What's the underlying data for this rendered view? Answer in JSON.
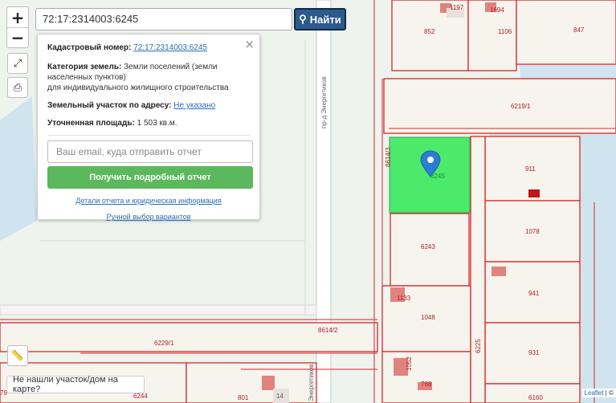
{
  "search": {
    "value": "72:17:2314003:6245",
    "button_label": "Найти",
    "button_icon": "search-icon"
  },
  "controls": {
    "zoom_in": "+",
    "zoom_out": "−",
    "fullscreen_icon": "expand-icon",
    "print_icon": "print-icon",
    "measure_icon": "ruler-icon"
  },
  "popup": {
    "cadastral_label": "Кадастровый номер:",
    "cadastral_value": "72:17:2314003:6245",
    "category_label": "Категория земель:",
    "category_value_line1": "Земли поселений (земли",
    "category_value_line2": "населенных пунктов)",
    "category_value_line3": "для индивидуального жилищного строительства",
    "address_label": "Земельный участок по адресу:",
    "address_value": "Не указано",
    "area_label": "Уточненная площадь:",
    "area_value": "1 503 кв.м.",
    "email_placeholder": "Ваш email, куда отправить отчет",
    "report_button": "Получить подробный отчет",
    "details_link": "Детали отчета и юридическая информация",
    "manual_link": "Ручной выбор вариантов",
    "close": "×"
  },
  "map": {
    "selected_parcel_label": "6245",
    "parcel_labels": [
      "1197",
      "1694",
      "852",
      "1106",
      "847",
      "6219/1",
      "8614/3",
      "911",
      "1078",
      "6243",
      "941",
      "1133",
      "1048",
      "8614/2",
      "6229/1",
      "6225",
      "931",
      "1052",
      "768",
      "6244",
      "801",
      "14",
      "6160",
      "79"
    ],
    "street_labels": [
      "пр-д Энергетиков",
      "Энергетиков"
    ],
    "colors": {
      "background": "#eef3ee",
      "parcel_fill": "#f7f4ee",
      "parcel_border": "#d9262a",
      "selected_fill": "#4cea6a",
      "water": "#cfe4ee",
      "road": "#ffffff",
      "building": "#e0837e",
      "marker": "#2a7fd4"
    }
  },
  "bottom": {
    "not_found": "Не нашли участок/дом на карте?",
    "attribution_link": "Leaflet",
    "attribution_sep": " | ©"
  }
}
